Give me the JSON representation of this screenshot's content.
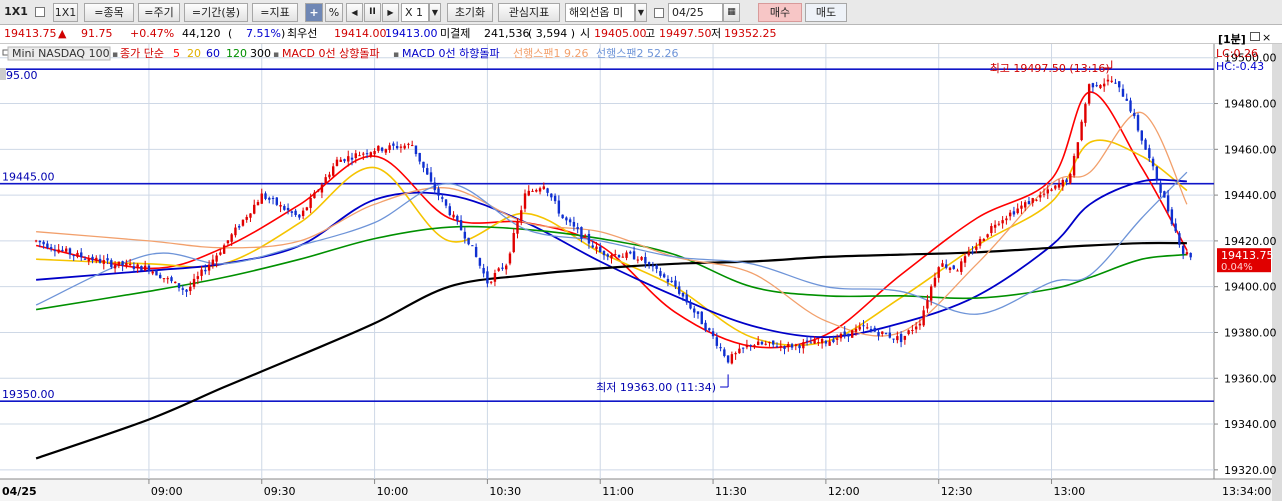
{
  "toolbar": {
    "layout1": "1X1",
    "layout2": "1X1",
    "item_btn": "=종목",
    "cycle_btn": "=주기",
    "period_btn": "=기간(봉)",
    "indicator_btn": "=지표",
    "plus": "+",
    "pct": "%",
    "prev": "◀",
    "pause": "II",
    "next": "▶",
    "zoom_value": "X 1",
    "reset_btn": "초기화",
    "watch_btn": "관심지표",
    "product_select": "해외선옵 미",
    "date": "04/25",
    "buy_btn": "매수",
    "sell_btn": "매도",
    "colors": {
      "buy": "#f7c6c6"
    }
  },
  "quote": {
    "price": "19413.75",
    "arrow": "▲",
    "change": "91.75",
    "change_pct": "+0.47%",
    "volume": "44,120",
    "vol_pct_open": "(",
    "vol_pct": "7.51%",
    "vol_pct_close": ")",
    "ask_label": "최우선",
    "ask": "19414.00",
    "bid": "19413.00",
    "oi_label": "미결제",
    "oi": "241,536",
    "oi_change": "( 3,594 )",
    "open_label": "시",
    "open": "19405.00",
    "high_label": "고",
    "high": "19497.50",
    "low_label": "저",
    "low": "19352.25"
  },
  "legend": {
    "symbol": "Mini NASDAQ 100",
    "ma_title": "종가 단순",
    "ma_periods": [
      "5",
      "20",
      "60",
      "120",
      "300"
    ],
    "macd_up": "MACD 0선 상향돌파",
    "macd_down": "MACD 0선 하향돌파",
    "span1": "선행스팬1 9.26",
    "span2": "선행스팬2 52.26",
    "lc": "LC:0.26",
    "hc": "HC:-0.43",
    "timeframe": "[1분]",
    "level_top": "95.00"
  },
  "chart_data": {
    "type": "candlestick",
    "title": "Mini NASDAQ 100",
    "x_labels": [
      "04/25",
      "09:00",
      "09:30",
      "10:00",
      "10:30",
      "11:00",
      "11:30",
      "12:00",
      "12:30",
      "13:00",
      "13:34:00"
    ],
    "y_ticks": [
      "19500.00",
      "19480.00",
      "19460.00",
      "19440.00",
      "19420.00",
      "19400.00",
      "19380.00",
      "19360.00",
      "19340.00",
      "19320.00"
    ],
    "ylim": [
      19316,
      19506
    ],
    "horizontal_levels": [
      {
        "value": 19495.0,
        "label": ""
      },
      {
        "value": 19445.0,
        "label": "19445.00"
      },
      {
        "value": 19350.0,
        "label": "19350.00"
      }
    ],
    "annotations": {
      "high": {
        "text": "최고 19497.50 (13:16)",
        "time": "13:16",
        "value": 19497.5
      },
      "low": {
        "text": "최저 19363.00 (11:34)",
        "time": "11:34",
        "value": 19363.0
      }
    },
    "current": {
      "price": "19413.75",
      "change_pct": "0.04%"
    },
    "ohlc": {
      "open": 19405.0,
      "high": 19497.5,
      "low": 19352.25,
      "last": 19413.75
    },
    "price_path": [
      [
        "08:30",
        19420
      ],
      [
        "08:40",
        19414
      ],
      [
        "08:50",
        19410
      ],
      [
        "09:00",
        19408
      ],
      [
        "09:10",
        19398
      ],
      [
        "09:20",
        19418
      ],
      [
        "09:30",
        19440
      ],
      [
        "09:40",
        19430
      ],
      [
        "09:50",
        19455
      ],
      [
        "10:00",
        19460
      ],
      [
        "10:10",
        19462
      ],
      [
        "10:15",
        19445
      ],
      [
        "10:25",
        19420
      ],
      [
        "10:30",
        19402
      ],
      [
        "10:35",
        19410
      ],
      [
        "10:40",
        19440
      ],
      [
        "10:45",
        19445
      ],
      [
        "10:50",
        19430
      ],
      [
        "11:00",
        19415
      ],
      [
        "11:10",
        19413
      ],
      [
        "11:20",
        19400
      ],
      [
        "11:30",
        19378
      ],
      [
        "11:34",
        19368
      ],
      [
        "11:40",
        19375
      ],
      [
        "11:50",
        19374
      ],
      [
        "12:00",
        19376
      ],
      [
        "12:10",
        19382
      ],
      [
        "12:20",
        19377
      ],
      [
        "12:25",
        19385
      ],
      [
        "12:30",
        19410
      ],
      [
        "12:35",
        19408
      ],
      [
        "12:45",
        19428
      ],
      [
        "12:55",
        19438
      ],
      [
        "13:00",
        19442
      ],
      [
        "13:05",
        19448
      ],
      [
        "13:10",
        19488
      ],
      [
        "13:16",
        19490
      ],
      [
        "13:20",
        19482
      ],
      [
        "13:25",
        19460
      ],
      [
        "13:30",
        19438
      ],
      [
        "13:35",
        19415
      ],
      [
        "13:37",
        19413.75
      ]
    ],
    "series": [
      {
        "name": "5",
        "color": "#ff0000",
        "values": [
          [
            8.5,
            19418
          ],
          [
            9.0,
            19408
          ],
          [
            9.33,
            19417
          ],
          [
            9.67,
            19436
          ],
          [
            10.0,
            19457
          ],
          [
            10.33,
            19430
          ],
          [
            10.67,
            19428
          ],
          [
            11.0,
            19418
          ],
          [
            11.33,
            19389
          ],
          [
            11.67,
            19374
          ],
          [
            12.0,
            19379
          ],
          [
            12.33,
            19405
          ],
          [
            12.67,
            19430
          ],
          [
            13.0,
            19447
          ],
          [
            13.17,
            19485
          ],
          [
            13.4,
            19452
          ],
          [
            13.6,
            19416
          ]
        ]
      },
      {
        "name": "20",
        "color": "#f5c400",
        "values": [
          [
            8.5,
            19412
          ],
          [
            9.0,
            19410
          ],
          [
            9.33,
            19410
          ],
          [
            9.67,
            19428
          ],
          [
            10.0,
            19452
          ],
          [
            10.33,
            19420
          ],
          [
            10.67,
            19432
          ],
          [
            11.0,
            19415
          ],
          [
            11.33,
            19400
          ],
          [
            11.67,
            19378
          ],
          [
            12.0,
            19376
          ],
          [
            12.33,
            19395
          ],
          [
            12.67,
            19418
          ],
          [
            13.0,
            19437
          ],
          [
            13.17,
            19463
          ],
          [
            13.4,
            19457
          ],
          [
            13.6,
            19442
          ]
        ]
      },
      {
        "name": "60",
        "color": "#0000c8",
        "values": [
          [
            8.5,
            19403
          ],
          [
            9.0,
            19407
          ],
          [
            9.33,
            19410
          ],
          [
            9.67,
            19418
          ],
          [
            10.0,
            19438
          ],
          [
            10.33,
            19440
          ],
          [
            10.67,
            19428
          ],
          [
            11.0,
            19411
          ],
          [
            11.33,
            19396
          ],
          [
            11.67,
            19383
          ],
          [
            12.0,
            19378
          ],
          [
            12.33,
            19384
          ],
          [
            12.67,
            19396
          ],
          [
            13.0,
            19418
          ],
          [
            13.17,
            19436
          ],
          [
            13.4,
            19446
          ],
          [
            13.6,
            19446
          ]
        ]
      },
      {
        "name": "120",
        "color": "#009000",
        "values": [
          [
            8.5,
            19390
          ],
          [
            9.0,
            19398
          ],
          [
            9.33,
            19404
          ],
          [
            9.67,
            19412
          ],
          [
            10.0,
            19421
          ],
          [
            10.33,
            19426
          ],
          [
            10.67,
            19425
          ],
          [
            11.0,
            19421
          ],
          [
            11.33,
            19414
          ],
          [
            11.67,
            19400
          ],
          [
            12.0,
            19396
          ],
          [
            12.33,
            19396
          ],
          [
            12.67,
            19395
          ],
          [
            13.0,
            19399
          ],
          [
            13.17,
            19404
          ],
          [
            13.4,
            19412
          ],
          [
            13.6,
            19414
          ]
        ]
      },
      {
        "name": "300",
        "color": "#000000",
        "values": [
          [
            8.5,
            19325
          ],
          [
            9.0,
            19342
          ],
          [
            9.33,
            19356
          ],
          [
            9.67,
            19370
          ],
          [
            10.0,
            19384
          ],
          [
            10.33,
            19400
          ],
          [
            10.67,
            19405
          ],
          [
            11.0,
            19408
          ],
          [
            11.33,
            19410
          ],
          [
            11.67,
            19411
          ],
          [
            12.0,
            19413
          ],
          [
            12.33,
            19414
          ],
          [
            12.67,
            19415
          ],
          [
            13.0,
            19417
          ],
          [
            13.17,
            19418
          ],
          [
            13.4,
            19419
          ],
          [
            13.6,
            19419
          ]
        ]
      },
      {
        "name": "선행스팬1 9.26",
        "color": "#f2a06c",
        "values": [
          [
            8.5,
            19424
          ],
          [
            9.0,
            19420
          ],
          [
            9.33,
            19417
          ],
          [
            9.67,
            19420
          ],
          [
            10.0,
            19436
          ],
          [
            10.33,
            19443
          ],
          [
            10.67,
            19428
          ],
          [
            11.0,
            19424
          ],
          [
            11.33,
            19413
          ],
          [
            11.67,
            19406
          ],
          [
            12.0,
            19385
          ],
          [
            12.33,
            19380
          ],
          [
            12.67,
            19410
          ],
          [
            13.0,
            19445
          ],
          [
            13.17,
            19450
          ],
          [
            13.4,
            19476
          ],
          [
            13.6,
            19436
          ]
        ]
      },
      {
        "name": "선행스팬2 52.26",
        "color": "#6e94d8",
        "values": [
          [
            8.5,
            19392
          ],
          [
            9.0,
            19414
          ],
          [
            9.33,
            19410
          ],
          [
            9.67,
            19418
          ],
          [
            10.0,
            19428
          ],
          [
            10.33,
            19445
          ],
          [
            10.67,
            19425
          ],
          [
            11.0,
            19420
          ],
          [
            11.33,
            19413
          ],
          [
            11.67,
            19410
          ],
          [
            12.0,
            19400
          ],
          [
            12.33,
            19398
          ],
          [
            12.67,
            19388
          ],
          [
            13.0,
            19402
          ],
          [
            13.17,
            19405
          ],
          [
            13.4,
            19430
          ],
          [
            13.6,
            19450
          ]
        ]
      }
    ]
  }
}
